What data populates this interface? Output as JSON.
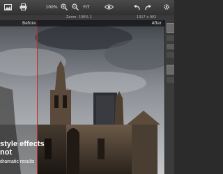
{
  "toolbar": {
    "zoom_value": "100%",
    "fit_label": "FIT"
  },
  "zoom_info": {
    "zoom_text": "Zoom: 100% 1",
    "dimensions_text": "1317 x 902"
  },
  "compare": {
    "before_label": "Before",
    "after_label": "After"
  },
  "caption": {
    "line1": "style effects",
    "line2": "not",
    "line3": "dramatic results"
  },
  "icons": [
    "image-icon",
    "print-icon",
    "zoom-in-icon",
    "zoom-out-icon",
    "eye-icon",
    "undo-icon",
    "redo-icon",
    "settings-icon"
  ]
}
